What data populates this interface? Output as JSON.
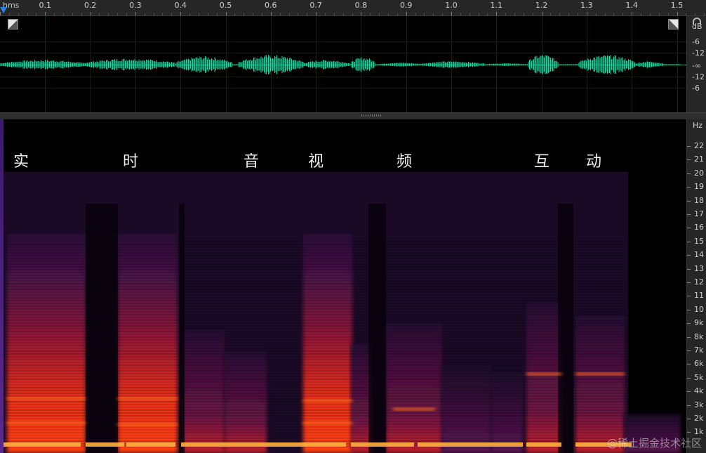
{
  "ruler": {
    "unit": "hms",
    "ticks": [
      "0.1",
      "0.2",
      "0.3",
      "0.4",
      "0.5",
      "0.6",
      "0.7",
      "0.8",
      "0.9",
      "1.0",
      "1.1",
      "1.2",
      "1.3",
      "1.4",
      "1.5"
    ]
  },
  "waveform": {
    "db_unit": "dB",
    "db_labels": [
      "-6",
      "-12",
      "-∞",
      "-12",
      "-6"
    ]
  },
  "spectrogram": {
    "hz_unit": "Hz",
    "hz_labels": [
      "22",
      "21",
      "20",
      "19",
      "18",
      "17",
      "16",
      "15",
      "14",
      "13",
      "12",
      "11",
      "10",
      "9k",
      "8k",
      "7k",
      "6k",
      "5k",
      "4k",
      "3k",
      "2k",
      "1k"
    ],
    "annotations": [
      "实",
      "时",
      "音",
      "视",
      "频",
      "互",
      "动"
    ],
    "watermark": "@稀土掘金技术社区"
  },
  "colors": {
    "waveform": "#1fd8a0",
    "panel_bg": "#000000",
    "scale_bg": "#262626",
    "spectrum_hot": "#ff5a1e",
    "spectrum_cool": "#3a1460",
    "playhead": "#2f7fe0"
  }
}
